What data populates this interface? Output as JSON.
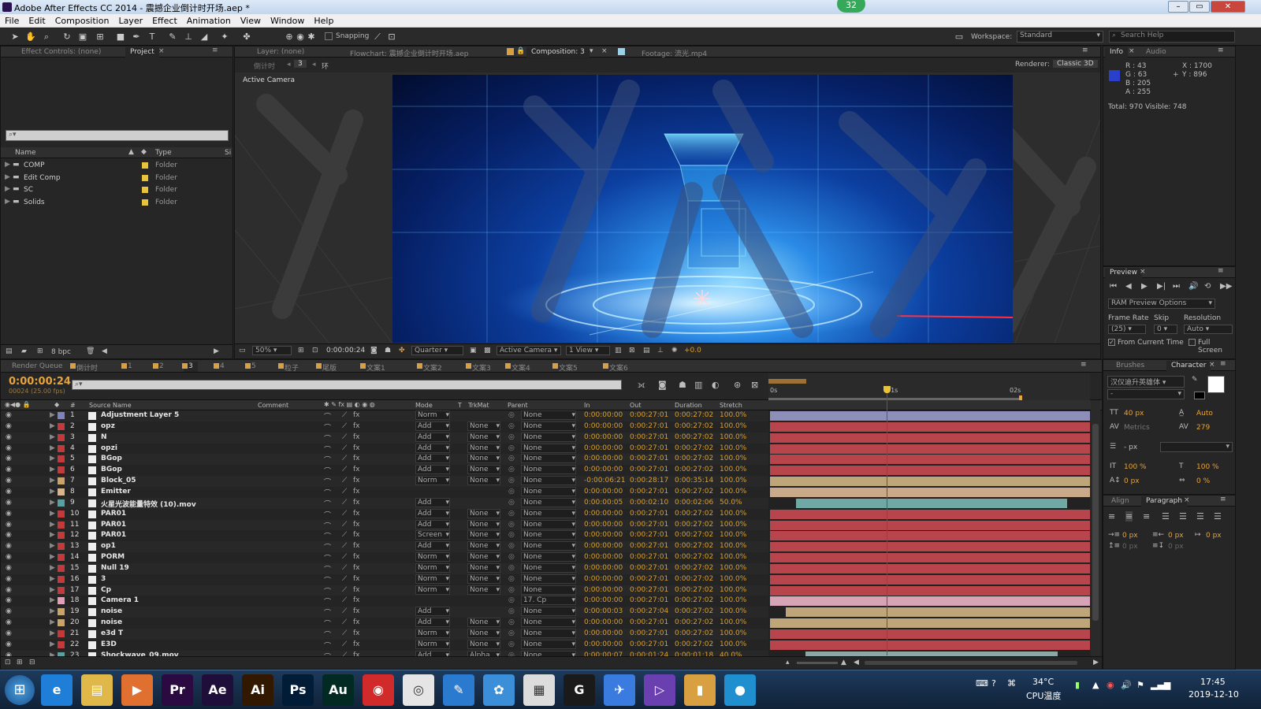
{
  "window": {
    "title": "Adobe After Effects CC 2014 - 震撼企业倒计时开场.aep *",
    "badge": "32",
    "min": "–",
    "max": "▭",
    "close": "✕"
  },
  "menu": [
    "File",
    "Edit",
    "Composition",
    "Layer",
    "Effect",
    "Animation",
    "View",
    "Window",
    "Help"
  ],
  "toolbar": {
    "snapping": "Snapping",
    "workspace_label": "Workspace:",
    "workspace_value": "Standard",
    "search_placeholder": "Search Help"
  },
  "project_panel": {
    "tabs": [
      "Effect Controls: (none)",
      "Project"
    ],
    "columns": {
      "name": "Name",
      "type": "Type",
      "size": "Si"
    },
    "items": [
      {
        "name": "COMP",
        "type": "Folder"
      },
      {
        "name": "Edit Comp",
        "type": "Folder"
      },
      {
        "name": "SC",
        "type": "Folder"
      },
      {
        "name": "Solids",
        "type": "Folder"
      }
    ],
    "bpc": "8 bpc"
  },
  "viewer": {
    "tabs": [
      "Layer: (none)",
      "Flowchart: 震撼企业倒计时开场.aep",
      "Composition: 3",
      "Footage: 流光.mp4"
    ],
    "breadcrumb": [
      "倒计时",
      "3",
      "环"
    ],
    "renderer_label": "Renderer:",
    "renderer_value": "Classic 3D",
    "camera_label": "Active Camera",
    "controls": {
      "zoom": "50%",
      "time": "0:00:00:24",
      "resolution": "Quarter",
      "camera": "Active Camera",
      "view": "1 View",
      "exposure": "+0.0"
    }
  },
  "info_panel": {
    "tabs": [
      "Info",
      "Audio"
    ],
    "r": "R : 43",
    "g": "G : 63",
    "b": "B : 205",
    "a": "A : 255",
    "x": "X : 1700",
    "y": "Y : 896",
    "summary": "Total: 970   Visible: 748"
  },
  "preview_panel": {
    "title": "Preview",
    "ram": "RAM Preview Options",
    "frame_rate_label": "Frame Rate",
    "skip_label": "Skip",
    "resolution_label": "Resolution",
    "frame_rate": "(25)",
    "skip": "0",
    "resolution": "Auto",
    "from_current": "From Current Time",
    "full_screen": "Full Screen"
  },
  "character_panel": {
    "tabs": [
      "Brushes",
      "Character"
    ],
    "font": "汉仪迪升英雄体",
    "font_size": "40 px",
    "leading": "Auto",
    "kerning": "Metrics",
    "tracking": "279",
    "stroke": "- px",
    "vscale": "100 %",
    "hscale": "100 %",
    "baseline": "0 px",
    "tsume": "0 %"
  },
  "paragraph_panel": {
    "tabs": [
      "Align",
      "Paragraph"
    ],
    "indent_left": "0 px",
    "space_before": "0 px",
    "indent_right": "0 px",
    "indent_first": "0 px",
    "space_after": "0 px"
  },
  "timeline": {
    "tabs": [
      "Render Queue",
      "倒计时",
      "1",
      "2",
      "3",
      "4",
      "5",
      "粒子",
      "尾版",
      "文案1",
      "文案2",
      "文案3",
      "文案4",
      "文案5",
      "文案6"
    ],
    "current_time": "0:00:00:24",
    "frame_info": "00024 (25.00 fps)",
    "ruler": [
      "0s",
      "01s",
      "02s"
    ],
    "columns": {
      "num": "#",
      "source": "Source Name",
      "comment": "Comment",
      "mode": "Mode",
      "t": "T",
      "trkmat": "TrkMat",
      "parent": "Parent",
      "in": "In",
      "out": "Out",
      "duration": "Duration",
      "stretch": "Stretch"
    },
    "layers": [
      {
        "n": "1",
        "name": "Adjustment Layer 5",
        "mode": "Norm",
        "trk": "",
        "parent": "None",
        "in": "0:00:00:00",
        "out": "0:00:27:01",
        "dur": "0:00:27:02",
        "str": "100.0%",
        "label": "#7e82c0",
        "bar": "#8d8fb8",
        "start": 0,
        "end": 1
      },
      {
        "n": "2",
        "name": "opz",
        "mode": "Add",
        "trk": "None",
        "parent": "None",
        "in": "0:00:00:00",
        "out": "0:00:27:01",
        "dur": "0:00:27:02",
        "str": "100.0%",
        "label": "#c43a3a",
        "bar": "#b8454b",
        "start": 0,
        "end": 1
      },
      {
        "n": "3",
        "name": "N",
        "mode": "Add",
        "trk": "None",
        "parent": "None",
        "in": "0:00:00:00",
        "out": "0:00:27:01",
        "dur": "0:00:27:02",
        "str": "100.0%",
        "label": "#c43a3a",
        "bar": "#b8454b",
        "start": 0,
        "end": 1
      },
      {
        "n": "4",
        "name": "opzi",
        "mode": "Add",
        "trk": "None",
        "parent": "None",
        "in": "0:00:00:00",
        "out": "0:00:27:01",
        "dur": "0:00:27:02",
        "str": "100.0%",
        "label": "#c43a3a",
        "bar": "#b8454b",
        "start": 0,
        "end": 1
      },
      {
        "n": "5",
        "name": "BGop",
        "mode": "Add",
        "trk": "None",
        "parent": "None",
        "in": "0:00:00:00",
        "out": "0:00:27:01",
        "dur": "0:00:27:02",
        "str": "100.0%",
        "label": "#c43a3a",
        "bar": "#b8454b",
        "start": 0,
        "end": 1
      },
      {
        "n": "6",
        "name": "BGop",
        "mode": "Add",
        "trk": "None",
        "parent": "None",
        "in": "0:00:00:00",
        "out": "0:00:27:01",
        "dur": "0:00:27:02",
        "str": "100.0%",
        "label": "#c43a3a",
        "bar": "#b8454b",
        "start": 0,
        "end": 1
      },
      {
        "n": "7",
        "name": "Block_05",
        "mode": "Norm",
        "trk": "None",
        "parent": "None",
        "in": "-0:00:06:21",
        "out": "0:00:28:17",
        "dur": "0:00:35:14",
        "str": "100.0%",
        "label": "#c9a36a",
        "bar": "#bfa57a",
        "start": 0,
        "end": 1
      },
      {
        "n": "8",
        "name": "Emitter",
        "mode": "",
        "trk": "",
        "parent": "None",
        "in": "0:00:00:00",
        "out": "0:00:27:01",
        "dur": "0:00:27:02",
        "str": "100.0%",
        "label": "#d8b48a",
        "bar": "#c9a98a",
        "start": 0,
        "end": 1
      },
      {
        "n": "9",
        "name": "火星光波能量特效 (10).mov",
        "mode": "Add",
        "trk": "",
        "parent": "None",
        "in": "0:00:00:05",
        "out": "0:00:02:10",
        "dur": "0:00:02:06",
        "str": "50.0%",
        "label": "#5aa0a0",
        "bar": "#6fa8a4",
        "start": 0.08,
        "end": 0.93
      },
      {
        "n": "10",
        "name": "PAR01",
        "mode": "Add",
        "trk": "None",
        "parent": "None",
        "in": "0:00:00:00",
        "out": "0:00:27:01",
        "dur": "0:00:27:02",
        "str": "100.0%",
        "label": "#c43a3a",
        "bar": "#b8454b",
        "start": 0,
        "end": 1
      },
      {
        "n": "11",
        "name": "PAR01",
        "mode": "Add",
        "trk": "None",
        "parent": "None",
        "in": "0:00:00:00",
        "out": "0:00:27:01",
        "dur": "0:00:27:02",
        "str": "100.0%",
        "label": "#c43a3a",
        "bar": "#b8454b",
        "start": 0,
        "end": 1
      },
      {
        "n": "12",
        "name": "PAR01",
        "mode": "Screen",
        "trk": "None",
        "parent": "None",
        "in": "0:00:00:00",
        "out": "0:00:27:01",
        "dur": "0:00:27:02",
        "str": "100.0%",
        "label": "#c43a3a",
        "bar": "#b8454b",
        "start": 0,
        "end": 1
      },
      {
        "n": "13",
        "name": "op1",
        "mode": "Add",
        "trk": "None",
        "parent": "None",
        "in": "0:00:00:00",
        "out": "0:00:27:01",
        "dur": "0:00:27:02",
        "str": "100.0%",
        "label": "#c43a3a",
        "bar": "#b8454b",
        "start": 0,
        "end": 1
      },
      {
        "n": "14",
        "name": "PORM",
        "mode": "Norm",
        "trk": "None",
        "parent": "None",
        "in": "0:00:00:00",
        "out": "0:00:27:01",
        "dur": "0:00:27:02",
        "str": "100.0%",
        "label": "#c43a3a",
        "bar": "#b8454b",
        "start": 0,
        "end": 1
      },
      {
        "n": "15",
        "name": "Null 19",
        "mode": "Norm",
        "trk": "None",
        "parent": "None",
        "in": "0:00:00:00",
        "out": "0:00:27:01",
        "dur": "0:00:27:02",
        "str": "100.0%",
        "label": "#c43a3a",
        "bar": "#b8454b",
        "start": 0,
        "end": 1
      },
      {
        "n": "16",
        "name": "3",
        "mode": "Norm",
        "trk": "None",
        "parent": "None",
        "in": "0:00:00:00",
        "out": "0:00:27:01",
        "dur": "0:00:27:02",
        "str": "100.0%",
        "label": "#c43a3a",
        "bar": "#b8454b",
        "start": 0,
        "end": 1
      },
      {
        "n": "17",
        "name": "Cp",
        "mode": "Norm",
        "trk": "None",
        "parent": "None",
        "in": "0:00:00:00",
        "out": "0:00:27:01",
        "dur": "0:00:27:02",
        "str": "100.0%",
        "label": "#c43a3a",
        "bar": "#b8454b",
        "start": 0,
        "end": 1
      },
      {
        "n": "18",
        "name": "Camera 1",
        "mode": "",
        "trk": "",
        "parent": "17. Cp",
        "in": "0:00:00:00",
        "out": "0:00:27:01",
        "dur": "0:00:27:02",
        "str": "100.0%",
        "label": "#e0a0b8",
        "bar": "#d6a4b6",
        "start": 0,
        "end": 1
      },
      {
        "n": "19",
        "name": "noise",
        "mode": "Add",
        "trk": "",
        "parent": "None",
        "in": "0:00:00:03",
        "out": "0:00:27:04",
        "dur": "0:00:27:02",
        "str": "100.0%",
        "label": "#c9a36a",
        "bar": "#bfa57a",
        "start": 0.05,
        "end": 1
      },
      {
        "n": "20",
        "name": "noise",
        "mode": "Add",
        "trk": "None",
        "parent": "None",
        "in": "0:00:00:00",
        "out": "0:00:27:01",
        "dur": "0:00:27:02",
        "str": "100.0%",
        "label": "#c9a36a",
        "bar": "#bfa57a",
        "start": 0,
        "end": 1
      },
      {
        "n": "21",
        "name": "e3d T",
        "mode": "Norm",
        "trk": "None",
        "parent": "None",
        "in": "0:00:00:00",
        "out": "0:00:27:01",
        "dur": "0:00:27:02",
        "str": "100.0%",
        "label": "#c43a3a",
        "bar": "#b8454b",
        "start": 0,
        "end": 1
      },
      {
        "n": "22",
        "name": "E3D",
        "mode": "Norm",
        "trk": "None",
        "parent": "None",
        "in": "0:00:00:00",
        "out": "0:00:27:01",
        "dur": "0:00:27:02",
        "str": "100.0%",
        "label": "#c43a3a",
        "bar": "#b8454b",
        "start": 0,
        "end": 1
      },
      {
        "n": "23",
        "name": "Shockwave_09.mov",
        "mode": "Add",
        "trk": "Alpha",
        "parent": "None",
        "in": "0:00:00:07",
        "out": "0:00:01:24",
        "dur": "0:00:01:18",
        "str": "40.0%",
        "label": "#5aa0a0",
        "bar": "#8aa9a6",
        "start": 0.11,
        "end": 0.9
      }
    ],
    "playhead_fraction": 0.37
  },
  "taskbar": {
    "apps": [
      {
        "icon": "ie-icon",
        "glyph": "e",
        "color": "#1f7fd8"
      },
      {
        "icon": "explorer-icon",
        "glyph": "▤",
        "color": "#e0b84a"
      },
      {
        "icon": "media-icon",
        "glyph": "▶",
        "color": "#e07030"
      },
      {
        "icon": "premiere-icon",
        "glyph": "Pr",
        "color": "#2a0a40"
      },
      {
        "icon": "aftereffects-icon",
        "glyph": "Ae",
        "color": "#1f0d3a"
      },
      {
        "icon": "illustrator-icon",
        "glyph": "Ai",
        "color": "#331800"
      },
      {
        "icon": "photoshop-icon",
        "glyph": "Ps",
        "color": "#001c36"
      },
      {
        "icon": "audition-icon",
        "glyph": "Au",
        "color": "#002a22"
      },
      {
        "icon": "netease-music-icon",
        "glyph": "◉",
        "color": "#d02a2a"
      },
      {
        "icon": "chrome-icon",
        "glyph": "◎",
        "color": "#e5e5e5"
      },
      {
        "icon": "feather-icon",
        "glyph": "✎",
        "color": "#2a7ad0"
      },
      {
        "icon": "baidu-icon",
        "glyph": "✿",
        "color": "#3b8ed8"
      },
      {
        "icon": "window-icon",
        "glyph": "▦",
        "color": "#dcdcdc"
      },
      {
        "icon": "g-app-icon",
        "glyph": "G",
        "color": "#1a1a1a"
      },
      {
        "icon": "feishu-icon",
        "glyph": "✈",
        "color": "#3a7be0"
      },
      {
        "icon": "vs-icon",
        "glyph": "▷",
        "color": "#6a3fb0"
      },
      {
        "icon": "chart-app-icon",
        "glyph": "▮",
        "color": "#d8a040"
      },
      {
        "icon": "player-icon",
        "glyph": "●",
        "color": "#1f8fd0"
      }
    ],
    "temp": "34°C",
    "cpu": "CPU温度",
    "time": "17:45",
    "date": "2019-12-10"
  }
}
